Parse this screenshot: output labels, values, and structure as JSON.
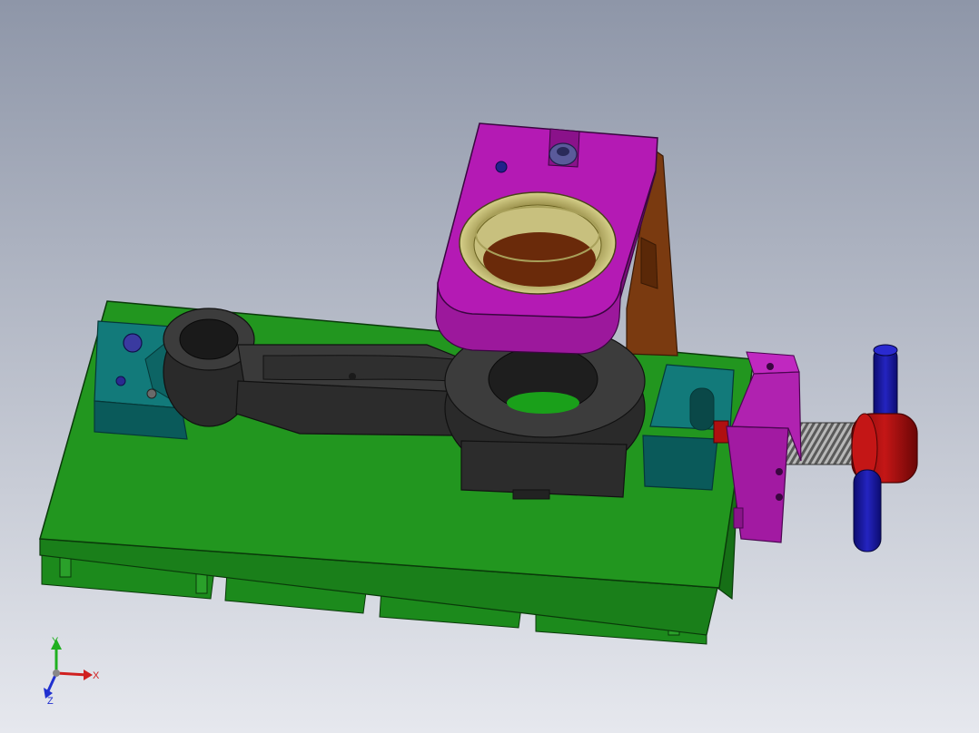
{
  "viewport": {
    "background_top": "#8e96a8",
    "background_bottom": "#e6e8ee"
  },
  "colors": {
    "base_plate": "#1f8a1f",
    "base_plate_dark": "#0f5a10",
    "base_plate_edge": "#0a3a0a",
    "connecting_rod": "#3c3c3c",
    "connecting_rod_dark": "#222222",
    "locator_block": "#127a7a",
    "locator_block_dark": "#0a4f4f",
    "bracket": "#a21aa2",
    "bracket_dark": "#6e0f72",
    "bushing": "#c9c27a",
    "support_plate": "#7a3a10",
    "screw_knob": "#b01010",
    "handle_bar": "#1818a8",
    "thread_rod": "#9a9a9a"
  },
  "triad": {
    "x_label": "X",
    "y_label": "Y",
    "z_label": "Z",
    "x_color": "#d02020",
    "y_color": "#20b020",
    "z_color": "#2030d0"
  }
}
